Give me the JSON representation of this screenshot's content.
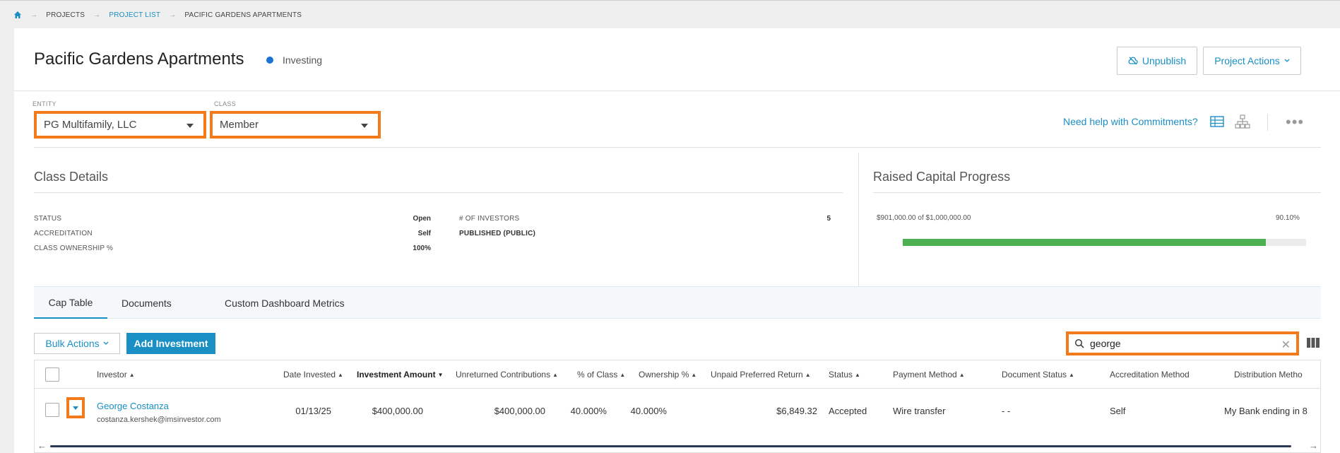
{
  "breadcrumb": {
    "projects": "PROJECTS",
    "project_list": "PROJECT LIST",
    "current": "PACIFIC GARDENS APARTMENTS"
  },
  "header": {
    "title": "Pacific Gardens Apartments",
    "status": "Investing",
    "status_color": "#1a73d1",
    "unpublish_label": "Unpublish",
    "actions_label": "Project Actions"
  },
  "selectors": {
    "entity_label": "ENTITY",
    "entity_value": "PG Multifamily, LLC",
    "class_label": "CLASS",
    "class_value": "Member"
  },
  "help": {
    "link": "Need help with Commitments?"
  },
  "class_details": {
    "title": "Class Details",
    "status_key": "STATUS",
    "status_val": "Open",
    "accreditation_key": "ACCREDITATION",
    "accreditation_val": "Self",
    "ownership_key": "CLASS OWNERSHIP %",
    "ownership_val": "100%",
    "investors_key": "# OF INVESTORS",
    "investors_val": "5",
    "published": "PUBLISHED (PUBLIC)"
  },
  "raised": {
    "title": "Raised Capital Progress",
    "summary": "$901,000.00 of $1,000,000.00",
    "percent_label": "90.10%",
    "percent": 90.1,
    "bar_color": "#4caf50"
  },
  "tabs": [
    {
      "label": "Cap Table"
    },
    {
      "label": "Documents"
    },
    {
      "label": "Custom Dashboard Metrics"
    }
  ],
  "toolbar": {
    "bulk_label": "Bulk Actions",
    "add_label": "Add Investment",
    "search_value": "george"
  },
  "table": {
    "columns": [
      "Investor",
      "Date Invested",
      "Investment Amount",
      "Unreturned Contributions",
      "% of Class",
      "Ownership %",
      "Unpaid Preferred Return",
      "Status",
      "Payment Method",
      "Document Status",
      "Accreditation Method",
      "Distribution Metho"
    ],
    "row": {
      "name": "George Costanza",
      "email": "costanza.kershek@imsinvestor.com",
      "date": "01/13/25",
      "amount": "$400,000.00",
      "unreturned": "$400,000.00",
      "pct_class": "40.000%",
      "ownership": "40.000%",
      "unpaid": "$6,849.32",
      "status": "Accepted",
      "payment": "Wire transfer",
      "doc_status": "- -",
      "accreditation": "Self",
      "distribution": "My Bank ending in 8"
    }
  }
}
